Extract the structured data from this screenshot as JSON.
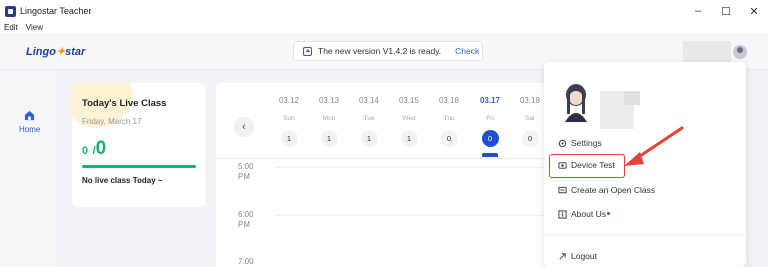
{
  "window": {
    "title": "Lingostar Teacher",
    "controls": {
      "minimize": "–",
      "maximize": "☐",
      "close": "✕"
    }
  },
  "menu": [
    "Edit",
    "View"
  ],
  "header": {
    "logo_part1": "Lingo",
    "logo_part2": "star",
    "update_text": "The new version V1.4.2 is ready.",
    "update_action": "Check"
  },
  "sidebar": {
    "home_label": "Home"
  },
  "live_class": {
    "title": "Today's Live Class",
    "date": "Friday, March 17",
    "done": "0",
    "slash": "/",
    "total": "0",
    "progress_fraction": 1.0,
    "empty_message": "No live class Today ~"
  },
  "calendar": {
    "days": [
      {
        "date": "03.12",
        "weekday": "Sun",
        "count": "1"
      },
      {
        "date": "03.13",
        "weekday": "Mon",
        "count": "1"
      },
      {
        "date": "03.14",
        "weekday": "Tue",
        "count": "1"
      },
      {
        "date": "03.15",
        "weekday": "Wed",
        "count": "1"
      },
      {
        "date": "03.16",
        "weekday": "Thu",
        "count": "0"
      },
      {
        "date": "03.17",
        "weekday": "Fri",
        "count": "0"
      },
      {
        "date": "03.18",
        "weekday": "Sat",
        "count": "0"
      }
    ],
    "active_date": "03.17",
    "times": [
      {
        "hour": "5:00",
        "ampm": "PM"
      },
      {
        "hour": "6:00",
        "ampm": "PM"
      },
      {
        "hour": "7:00",
        "ampm": ""
      }
    ]
  },
  "profile_menu": {
    "settings": "Settings",
    "device_test": "Device Test",
    "create_open_class": "Create an Open Class",
    "about_us": "About Us",
    "logout": "Logout"
  },
  "colors": {
    "accent_blue": "#1f4fd1",
    "success_green": "#18b26e",
    "highlight_red": "#e8413c"
  }
}
